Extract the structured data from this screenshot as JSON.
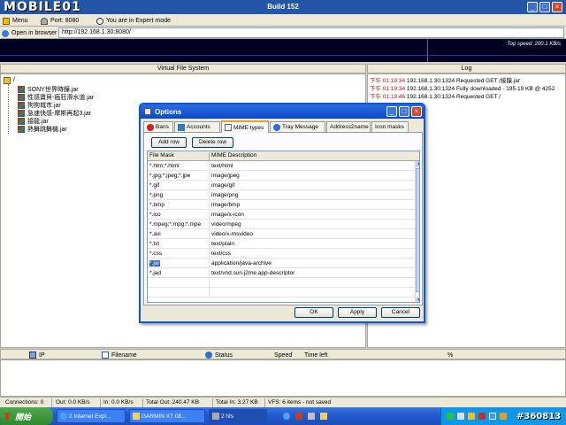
{
  "window": {
    "logo": "MOBILE01",
    "title": "Build 152"
  },
  "toolbar": {
    "menu": "Menu",
    "port": "Port: 8080",
    "mode": "You are in Expert mode"
  },
  "address": {
    "open_button": "Open in browser",
    "url": "http://192.168.1.30:8080/"
  },
  "speed": {
    "label": "Top speed: 200.1 KB/s"
  },
  "vfs": {
    "header": "Virtual File System",
    "root": "/",
    "files": [
      "SONY世界時鐘.jar",
      "性感寶貝-瘋狂滑水道.jar",
      "狗狗城市.jar",
      "急速快感-摩斯再起3.jar",
      "接龍.jar",
      "熱舞跳舞機.jar"
    ]
  },
  "log": {
    "header": "Log",
    "entries": [
      {
        "time": "下午 01:19:34",
        "text": " 192.168.1.30:1324 Requested GET /接龍.jar"
      },
      {
        "time": "下午 01:19:34",
        "text": " 192.168.1.30:1324 Fully downloaded - 195.19 KB @ 4252"
      },
      {
        "time": "下午 01:19:46",
        "text": " 192.168.1.30:1324 Requested GET /"
      }
    ]
  },
  "transfers": {
    "columns": [
      "IP",
      "Filename",
      "Status",
      "Speed",
      "Time left",
      "%"
    ]
  },
  "status": {
    "connections": "Connections: 0",
    "out": "Out: 0.0 KB/s",
    "in": "In: 0.0 KB/s",
    "total_out": "Total Out: 240.47 KB",
    "total_in": "Total In: 3.27 KB",
    "vfs": "VFS: 6 items - not saved"
  },
  "taskbar": {
    "start": "開始",
    "tasks": [
      "2 Internet Expl...",
      "GARMIN XT 08...",
      "2 hfs"
    ],
    "watermark": "#360813"
  },
  "dialog": {
    "title": "Options",
    "tabs": [
      "Bans",
      "Accounts",
      "MIME types",
      "Tray Message",
      "Address2name",
      "Icon masks"
    ],
    "active_tab": 2,
    "add_row": "Add row",
    "delete_row": "Delete row",
    "columns": [
      "File Mask",
      "MIME Description"
    ],
    "rows": [
      {
        "mask": "*.htm;*.html",
        "mime": "text/html"
      },
      {
        "mask": "*.jpg;*.jpeg;*.jpe",
        "mime": "image/jpeg"
      },
      {
        "mask": "*.gif",
        "mime": "image/gif"
      },
      {
        "mask": "*.png",
        "mime": "image/png"
      },
      {
        "mask": "*.bmp",
        "mime": "image/bmp"
      },
      {
        "mask": "*.ico",
        "mime": "image/x-icon"
      },
      {
        "mask": "*.mpeg;*.mpg;*.mpe",
        "mime": "video/mpeg"
      },
      {
        "mask": "*.avi",
        "mime": "video/x-msvideo"
      },
      {
        "mask": "*.txt",
        "mime": "text/plain"
      },
      {
        "mask": "*.css",
        "mime": "text/css"
      },
      {
        "mask": "*.jar",
        "mime": "application/java-archive"
      },
      {
        "mask": "*.jad",
        "mime": "text/vnd.sun.j2me.app-descriptor"
      }
    ],
    "selected_row": 10,
    "ok": "OK",
    "apply": "Apply",
    "cancel": "Cancel"
  }
}
